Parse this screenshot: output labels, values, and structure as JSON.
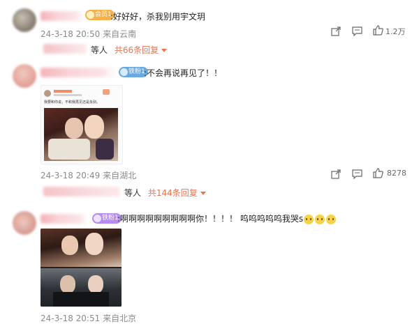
{
  "colors": {
    "accent": "#eb7350",
    "meta": "#8a8a8a",
    "badge_gold": "#f5b14c",
    "badge_blue": "#6aa9e0",
    "badge_purple": "#b68cf0"
  },
  "comments": [
    {
      "badge": "会员1",
      "text": ":好好好，杀我别用宇文玥",
      "time": "24-3-18 20:50",
      "location": "来自云南",
      "likes": "1.2万",
      "replies_prefix": "等人",
      "replies_link": "共66条回复"
    },
    {
      "badge": "铁粉1",
      "text": ":不会再说再见了！！",
      "time": "24-3-18 20:49",
      "location": "来自湖北",
      "likes": "8278",
      "replies_prefix": "等人",
      "replies_link": "共144条回复",
      "embedded_post": {
        "text": "我要和你说，不和我再见还是永别。"
      }
    },
    {
      "badge": "铁粉1",
      "text": ":啊啊啊啊啊啊啊啊啊你！！！！ 呜呜呜呜呜我哭s",
      "time": "24-3-18 20:51",
      "location": "来自北京"
    }
  ],
  "icons": {
    "share": "share-icon",
    "comment": "comment-icon",
    "like": "thumbs-up-icon",
    "emoji": "crying-emoji-icon",
    "dropdown": "chevron-down-icon"
  }
}
